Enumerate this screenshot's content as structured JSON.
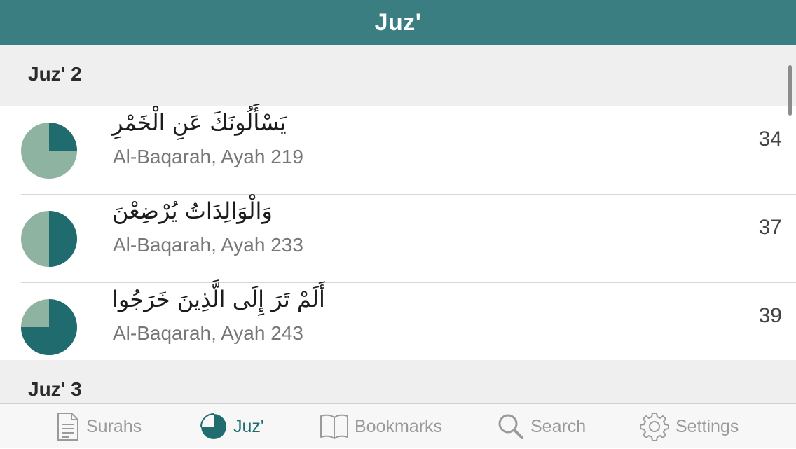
{
  "navbar": {
    "title": "Juz'"
  },
  "sections": [
    {
      "label": "Juz' 2",
      "rows": [
        {
          "arabic": "يَسْأَلُونَكَ عَنِ الْخَمْرِ",
          "ref": "Al-Baqarah, Ayah 219",
          "number": "34",
          "progress": 0.25
        },
        {
          "arabic": "وَالْوَالِدَاتُ يُرْضِعْنَ",
          "ref": "Al-Baqarah, Ayah 233",
          "number": "37",
          "progress": 0.5
        },
        {
          "arabic": "أَلَمْ تَرَ إِلَى الَّذِينَ خَرَجُوا",
          "ref": "Al-Baqarah, Ayah 243",
          "number": "39",
          "progress": 0.75
        }
      ]
    },
    {
      "label": "Juz' 3"
    }
  ],
  "tabs": [
    {
      "label": "Surahs",
      "icon": "document-icon",
      "active": false
    },
    {
      "label": "Juz'",
      "icon": "pie-icon",
      "active": true
    },
    {
      "label": "Bookmarks",
      "icon": "book-icon",
      "active": false
    },
    {
      "label": "Search",
      "icon": "magnifier-icon",
      "active": false
    },
    {
      "label": "Settings",
      "icon": "gear-icon",
      "active": false
    }
  ],
  "colors": {
    "navbar": "#3a7e82",
    "pie_filled": "#1f6b6e",
    "pie_empty": "#8fb3a1",
    "tab_active": "#206d70",
    "tab_inactive": "#9a9a9a"
  }
}
